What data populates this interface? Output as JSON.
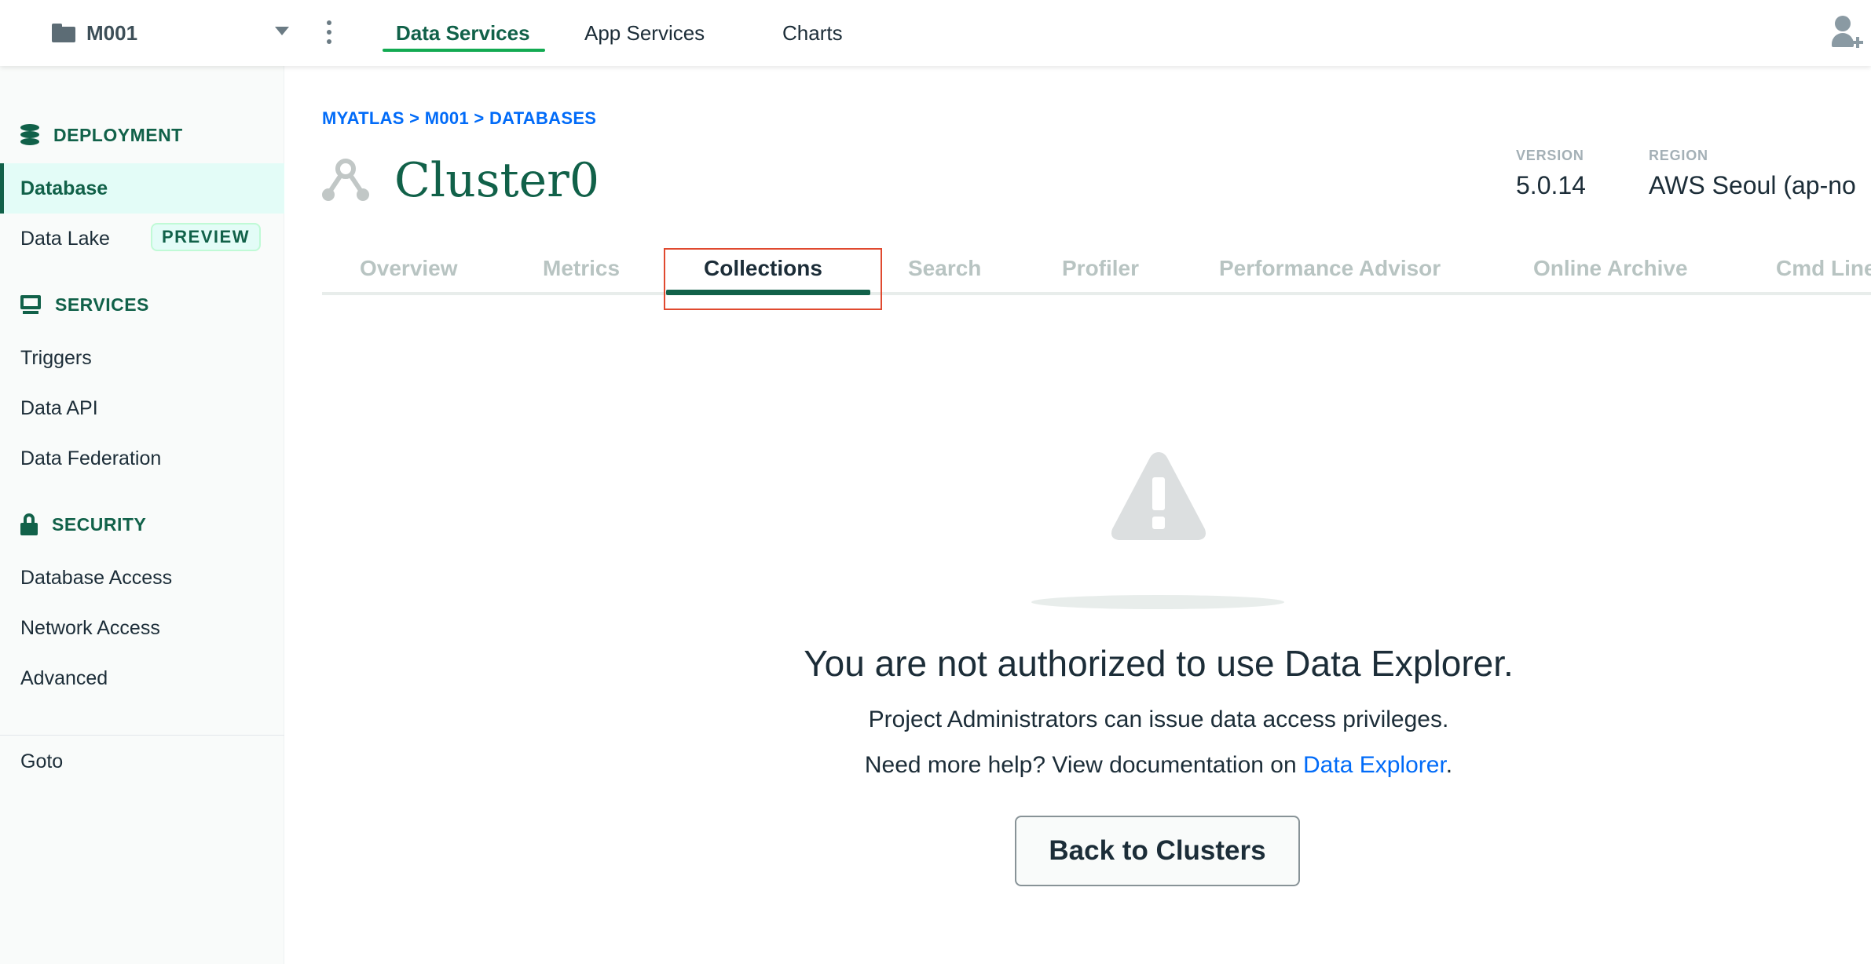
{
  "topbar": {
    "project_name": "M001",
    "nav": [
      "Data Services",
      "App Services",
      "Charts"
    ],
    "active_nav": "Data Services"
  },
  "sidebar": {
    "sections": [
      {
        "label": "DEPLOYMENT",
        "icon": "database-icon"
      },
      {
        "label": "SERVICES",
        "icon": "services-icon"
      },
      {
        "label": "SECURITY",
        "icon": "lock-icon"
      }
    ],
    "items": {
      "database": "Database",
      "data_lake": "Data Lake",
      "data_lake_badge": "PREVIEW",
      "triggers": "Triggers",
      "data_api": "Data API",
      "data_federation": "Data Federation",
      "database_access": "Database Access",
      "network_access": "Network Access",
      "advanced": "Advanced",
      "goto": "Goto"
    },
    "active_item": "Database"
  },
  "main": {
    "breadcrumb": "MYATLAS > M001 > DATABASES",
    "cluster_name": "Cluster0",
    "version_label": "VERSION",
    "version_value": "5.0.14",
    "region_label": "REGION",
    "region_value": "AWS Seoul (ap-no",
    "tabs": [
      "Overview",
      "Metrics",
      "Collections",
      "Search",
      "Profiler",
      "Performance Advisor",
      "Online Archive",
      "Cmd Line"
    ],
    "active_tab": "Collections",
    "message": {
      "title": "You are not authorized to use Data Explorer.",
      "line1": "Project Administrators can issue data access privileges.",
      "line2_prefix": "Need more help? View documentation on ",
      "line2_link": "Data Explorer",
      "line2_suffix": "."
    },
    "back_button": "Back to Clusters"
  },
  "colors": {
    "accent_green": "#116149",
    "link_blue": "#016bf8",
    "highlight_red": "#e0492f"
  }
}
